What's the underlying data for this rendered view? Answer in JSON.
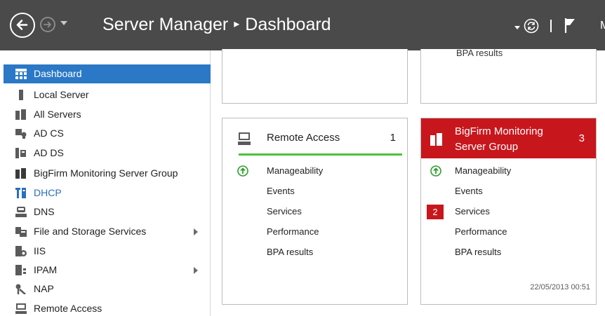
{
  "titlebar": {
    "app": "Server Manager",
    "separator": "▸",
    "page": "Dashboard",
    "tail_letter": "M"
  },
  "sidebar": {
    "items": [
      {
        "label": "Dashboard",
        "icon": "dashboard-icon"
      },
      {
        "label": "Local Server",
        "icon": "local-server-icon"
      },
      {
        "label": "All Servers",
        "icon": "all-servers-icon"
      },
      {
        "label": "AD CS",
        "icon": "ad-cs-icon"
      },
      {
        "label": "AD DS",
        "icon": "ad-ds-icon"
      },
      {
        "label": "BigFirm Monitoring Server Group",
        "icon": "server-group-icon"
      },
      {
        "label": "DHCP",
        "icon": "dhcp-icon"
      },
      {
        "label": "DNS",
        "icon": "dns-icon"
      },
      {
        "label": "File and Storage Services",
        "icon": "file-storage-icon"
      },
      {
        "label": "IIS",
        "icon": "iis-icon"
      },
      {
        "label": "IPAM",
        "icon": "ipam-icon"
      },
      {
        "label": "NAP",
        "icon": "nap-icon"
      },
      {
        "label": "Remote Access",
        "icon": "remote-access-icon"
      }
    ]
  },
  "tiles": {
    "top_right_clip": "BPA results",
    "remote_access": {
      "title": "Remote Access",
      "count": "1",
      "rows": [
        "Manageability",
        "Events",
        "Services",
        "Performance",
        "BPA results"
      ]
    },
    "bigfirm": {
      "title": "BigFirm Monitoring Server Group",
      "count": "3",
      "rows": [
        "Manageability",
        "Events",
        "Services",
        "Performance",
        "BPA results"
      ],
      "services_alert": "2",
      "timestamp": "22/05/2013 00:51"
    }
  },
  "colors": {
    "titlebar": "#4a4a4a",
    "selected": "#2a78c6",
    "alert": "#c8161d",
    "ok": "#4cc13a"
  }
}
